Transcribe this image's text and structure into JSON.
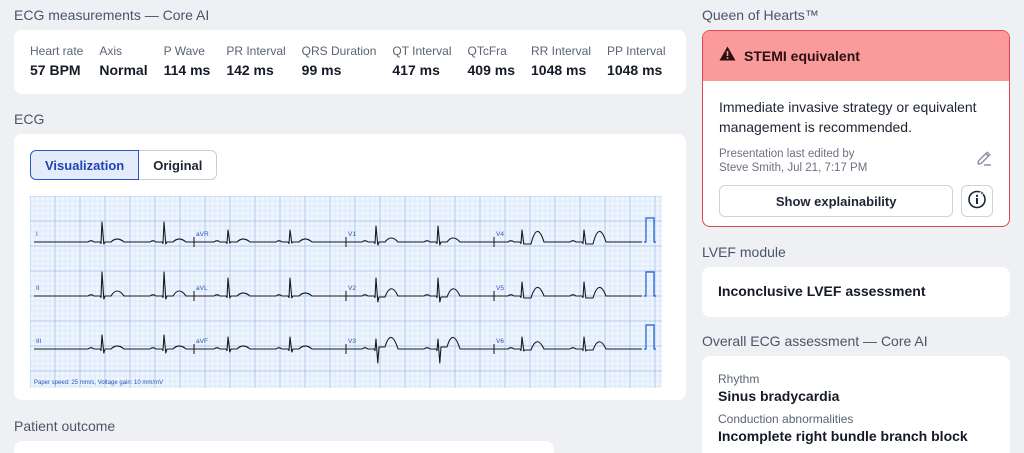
{
  "measurements": {
    "title": "ECG measurements — Core AI",
    "items": [
      {
        "label": "Heart rate",
        "value": "57 BPM"
      },
      {
        "label": "Axis",
        "value": "Normal"
      },
      {
        "label": "P Wave",
        "value": "114 ms"
      },
      {
        "label": "PR Interval",
        "value": "142 ms"
      },
      {
        "label": "QRS Duration",
        "value": "99 ms"
      },
      {
        "label": "QT Interval",
        "value": "417 ms"
      },
      {
        "label": "QTcFra",
        "value": "409 ms"
      },
      {
        "label": "RR Interval",
        "value": "1048 ms"
      },
      {
        "label": "PP Interval",
        "value": "1048 ms"
      }
    ]
  },
  "ecg": {
    "title": "ECG",
    "tabs": [
      {
        "label": "Visualization",
        "active": true
      },
      {
        "label": "Original",
        "active": false
      }
    ],
    "leads": [
      [
        "I",
        "aVR",
        "V1",
        "V4"
      ],
      [
        "II",
        "aVL",
        "V2",
        "V5"
      ],
      [
        "III",
        "aVF",
        "V3",
        "V6"
      ]
    ],
    "footer": "Paper speed: 25 mm/s, Voltage gain: 10 mm/mV",
    "colors": {
      "grid_minor": "#cfe0f5",
      "grid_major": "#9cbde8",
      "trace": "#1a1a1a",
      "lead_label": "#2a52b8"
    }
  },
  "patient_outcome": {
    "title": "Patient outcome"
  },
  "queen_of_hearts": {
    "title": "Queen of Hearts™",
    "alert": "STEMI equivalent",
    "text": "Immediate invasive strategy or equivalent management is recommended.",
    "edited_line1": "Presentation last edited by",
    "edited_line2": "Steve Smith, Jul 21, 7:17 PM",
    "explain_button": "Show explainability",
    "colors": {
      "header_bg": "#fa9a9a",
      "border": "#e0474c"
    }
  },
  "lvef": {
    "title": "LVEF module",
    "value": "Inconclusive LVEF assessment"
  },
  "overall": {
    "title": "Overall ECG assessment — Core AI",
    "items": [
      {
        "label": "Rhythm",
        "value": "Sinus bradycardia"
      },
      {
        "label": "Conduction abnormalities",
        "value": "Incomplete right bundle branch block"
      }
    ]
  }
}
